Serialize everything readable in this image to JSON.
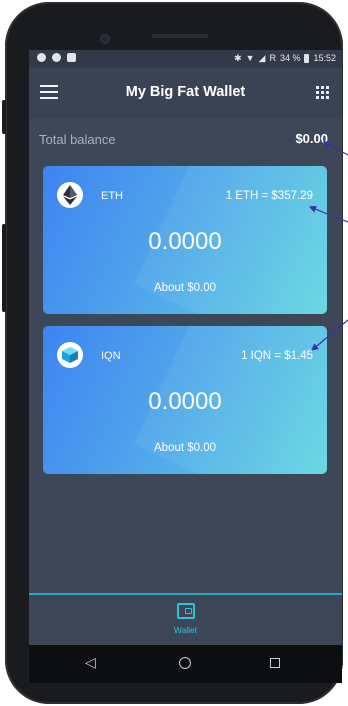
{
  "app": {
    "title": "My Big Fat Wallet"
  },
  "status_bar": {
    "signal_text": "R",
    "battery_percent": "34 %",
    "time": "15:52"
  },
  "total_balance": {
    "label": "Total balance",
    "value": "$0.00"
  },
  "coins": [
    {
      "symbol": "ETH",
      "rate": "1 ETH = $357.29",
      "balance": "0.0000",
      "fiat": "About $0.00",
      "icon": "ethereum-icon"
    },
    {
      "symbol": "IQN",
      "rate": "1 IQN = $1.45",
      "balance": "0.0000",
      "fiat": "About $0.00",
      "icon": "iqn-cube-icon"
    }
  ],
  "bottom_nav": {
    "wallet_label": "Wallet"
  },
  "colors": {
    "accent": "#2ec3d9",
    "background": "#3e4758",
    "annotation_arrow": "#3c2fa8"
  }
}
